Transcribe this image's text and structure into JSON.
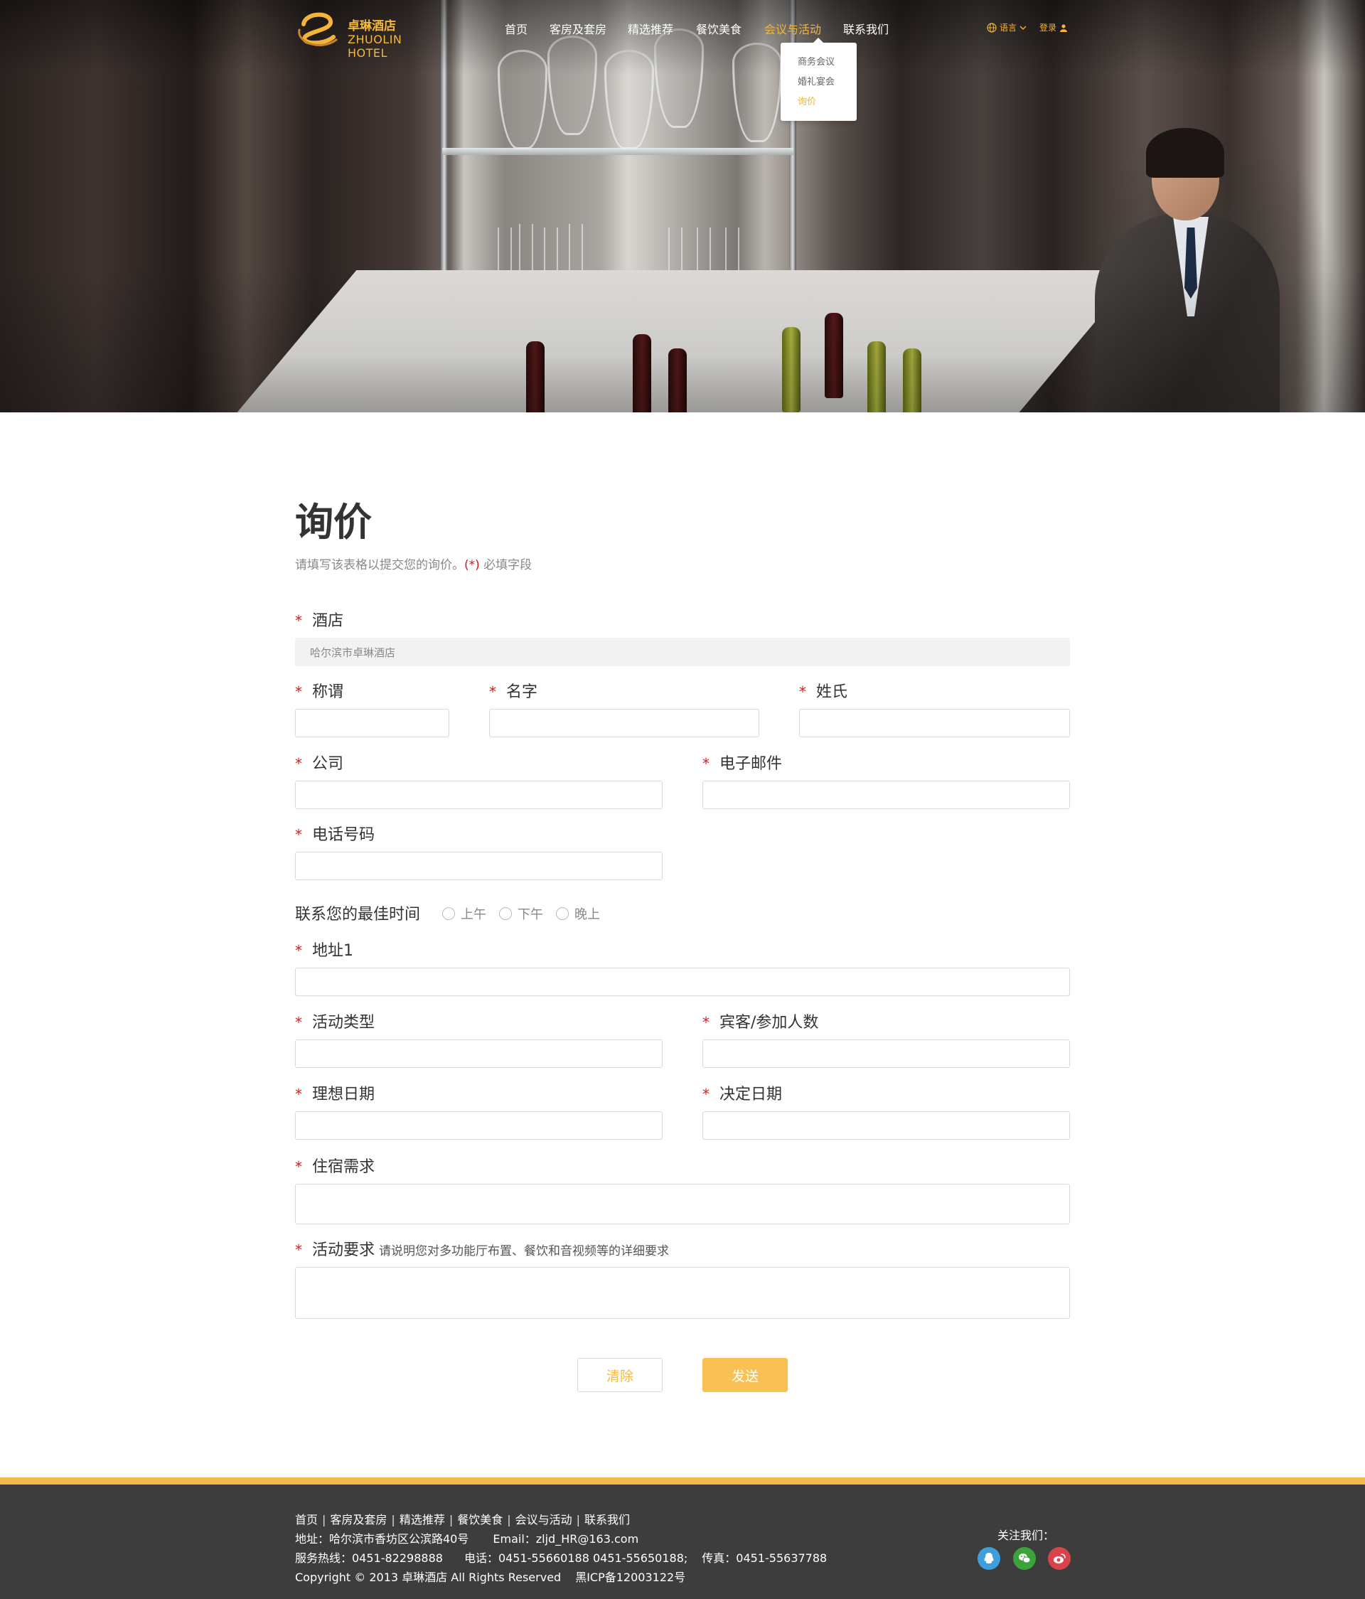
{
  "brand": {
    "name_cn": "卓琳酒店",
    "name_en": "ZHUOLIN HOTEL",
    "accent": "#f2b43a"
  },
  "nav": {
    "items": [
      {
        "label": "首页"
      },
      {
        "label": "客房及套房"
      },
      {
        "label": "精选推荐"
      },
      {
        "label": "餐饮美食"
      },
      {
        "label": "会议与活动",
        "active": true
      },
      {
        "label": "联系我们"
      }
    ],
    "language_label": "语言",
    "login_label": "登录",
    "dropdown": [
      {
        "label": "商务会议"
      },
      {
        "label": "婚礼宴会"
      },
      {
        "label": "询价",
        "active": true
      }
    ]
  },
  "form": {
    "title": "询价",
    "subtitle_before": "请填写该表格以提交您的询价。",
    "subtitle_req": "(*)",
    "subtitle_after": " 必填字段",
    "required_mark": "*",
    "hotel_label": "酒店",
    "hotel_value": "哈尔滨市卓琳酒店",
    "salutation_label": "称谓",
    "first_name_label": "名字",
    "last_name_label": "姓氏",
    "company_label": "公司",
    "email_label": "电子邮件",
    "phone_label": "电话号码",
    "best_time_label": "联系您的最佳时间",
    "best_time_options": [
      "上午",
      "下午",
      "晚上"
    ],
    "address_label": "地址1",
    "event_type_label": "活动类型",
    "guests_label": "宾客/参加人数",
    "ideal_date_label": "理想日期",
    "decision_date_label": "决定日期",
    "accommodation_label": "住宿需求",
    "event_req_label": "活动要求",
    "event_req_hint": "请说明您对多功能厅布置、餐饮和音视频等的详细要求",
    "clear_button": "清除",
    "send_button": "发送"
  },
  "footer": {
    "links": [
      "首页",
      "客房及套房",
      "精选推荐",
      "餐饮美食",
      "会议与活动",
      "联系我们"
    ],
    "separator": "|",
    "address": "地址：哈尔滨市香坊区公滨路40号",
    "email": "Email：zljd_HR@163.com",
    "service_line": "服务热线：0451-82298888",
    "phone": "电话：0451-55660188  0451-55650188;",
    "fax": "传真：0451-55637788",
    "copyright": "Copyright © 2013 卓琳酒店 All Rights Reserved",
    "icp": "黑ICP备12003122号",
    "follow_label": "关注我们：",
    "social": [
      {
        "icon": "qq-icon",
        "color": "#3f9fdc"
      },
      {
        "icon": "wechat-icon",
        "color": "#3aa43a"
      },
      {
        "icon": "weibo-icon",
        "color": "#d9434b"
      }
    ]
  }
}
